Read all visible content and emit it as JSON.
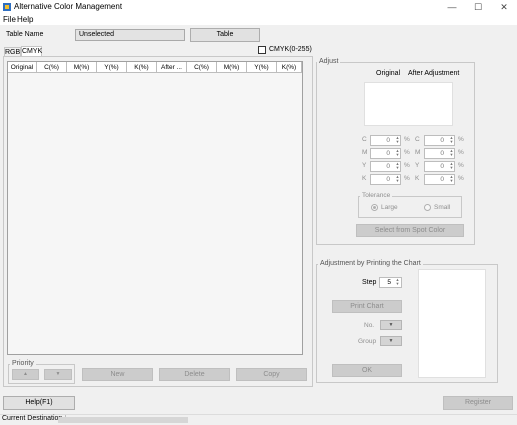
{
  "window": {
    "title": "Alternative Color Management",
    "minimize_glyph": "—",
    "maximize_glyph": "☐",
    "close_glyph": "✕"
  },
  "menu": {
    "file": "File",
    "help": "Help"
  },
  "table_name": {
    "label": "Table Name",
    "value": "Unselected",
    "button": "Table"
  },
  "tabs": [
    {
      "label": "RGB"
    },
    {
      "label": "CMYK"
    }
  ],
  "cmyk_range": {
    "label": "CMYK(0-255)"
  },
  "list_columns": [
    "Original",
    "C(%)",
    "M(%)",
    "Y(%)",
    "K(%)",
    "After ...",
    "C(%)",
    "M(%)",
    "Y(%)",
    "K(%)"
  ],
  "priority": {
    "label": "Priority",
    "up": "▲",
    "down": "▼"
  },
  "actions": {
    "new": "New",
    "delete": "Delete",
    "copy": "Copy"
  },
  "adjust": {
    "group": "Adjust",
    "original": "Original",
    "after": "After Adjustment",
    "channels": [
      "C",
      "M",
      "Y",
      "K"
    ],
    "orig_values": [
      "0",
      "0",
      "0",
      "0"
    ],
    "after_values": [
      "0",
      "0",
      "0",
      "0"
    ],
    "percent": "%",
    "tolerance": {
      "label": "Tolerance",
      "large": "Large",
      "small": "Small"
    },
    "select_button": "Select from Spot Color"
  },
  "chart": {
    "group": "Adjustment by Printing the Chart",
    "step_label": "Step",
    "step_value": "5",
    "print_button": "Print Chart",
    "no_label": "No.",
    "group_label": "Group",
    "ok_button": "OK"
  },
  "footer": {
    "help_button": "Help(F1)",
    "register_button": "Register"
  },
  "status": {
    "label": "Current Destination"
  }
}
